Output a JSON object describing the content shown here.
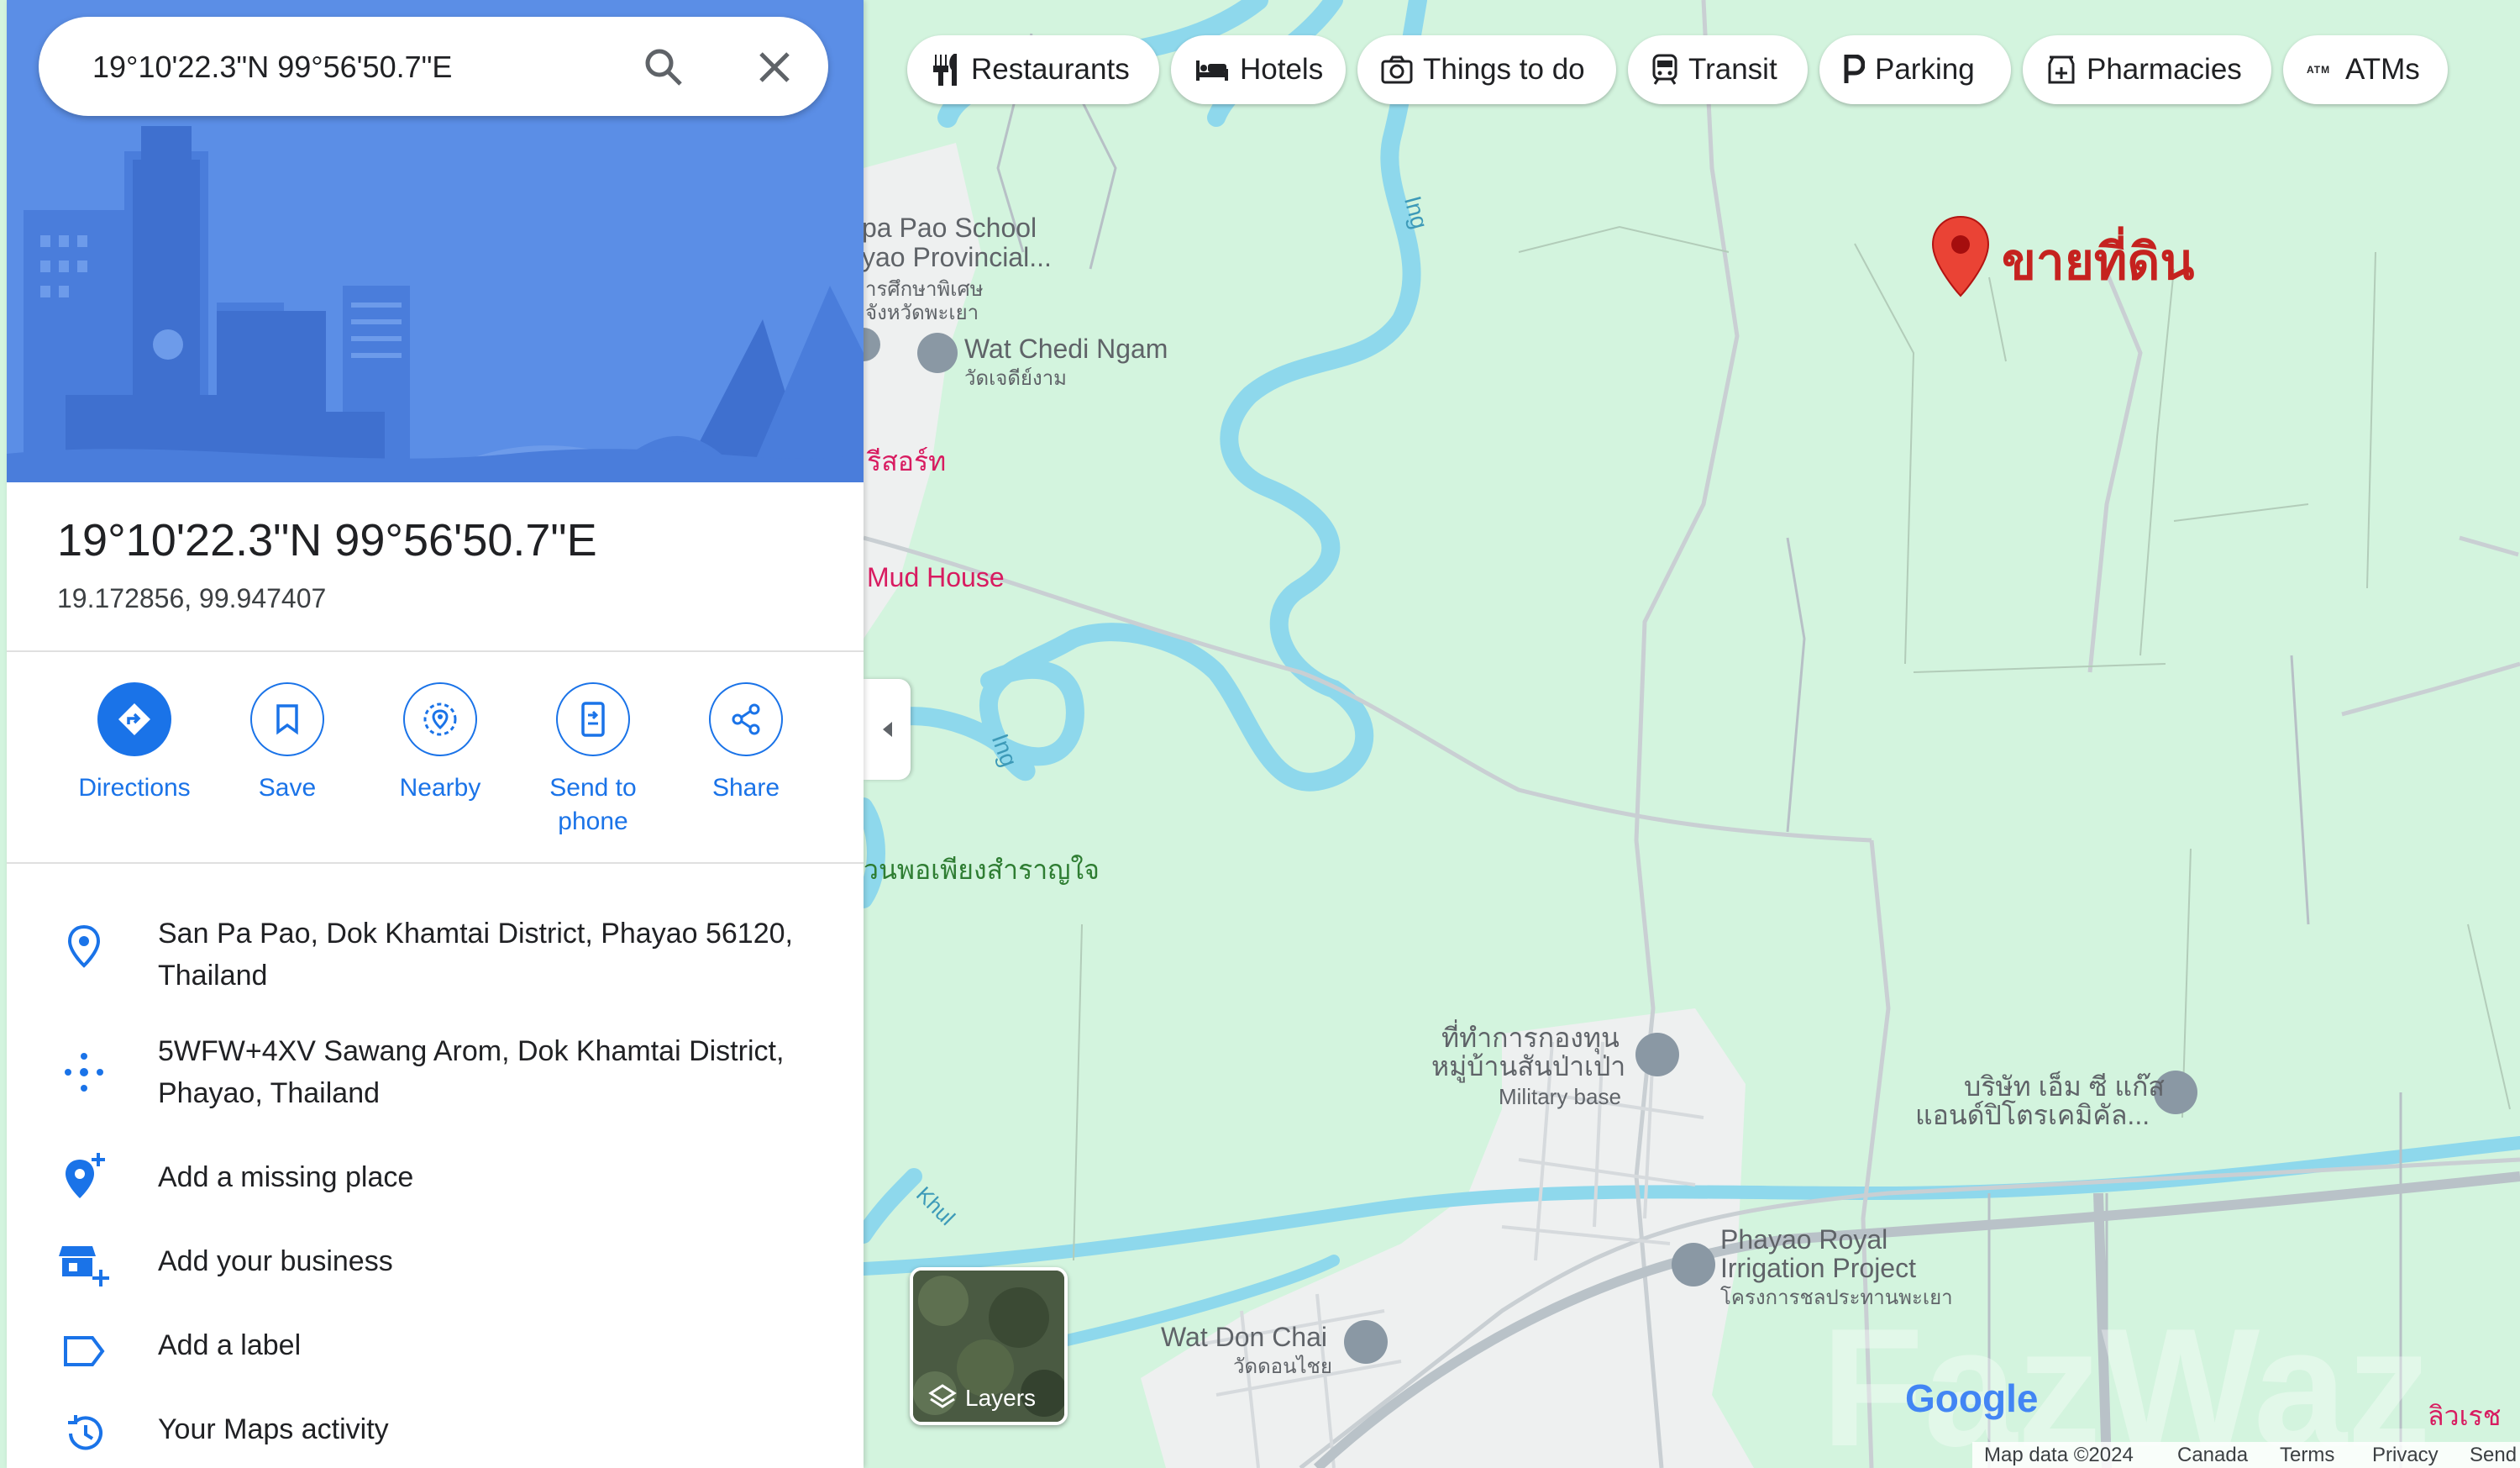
{
  "search": {
    "value": "19°10'22.3\"N 99°56'50.7\"E"
  },
  "place": {
    "title": "19°10'22.3\"N 99°56'50.7\"E",
    "decimal": "19.172856, 99.947407"
  },
  "actions": [
    {
      "label": "Directions",
      "icon": "directions-icon"
    },
    {
      "label": "Save",
      "icon": "bookmark-icon"
    },
    {
      "label": "Nearby",
      "icon": "nearby-icon"
    },
    {
      "label": "Send to\nphone",
      "icon": "send-to-phone-icon"
    },
    {
      "label": "Share",
      "icon": "share-icon"
    }
  ],
  "info": {
    "address": "San Pa Pao, Dok Khamtai District, Phayao 56120, Thailand",
    "plus_code": "5WFW+4XV Sawang Arom, Dok Khamtai District, Phayao, Thailand",
    "add_missing_place": "Add a missing place",
    "add_business": "Add your business",
    "add_label": "Add a label",
    "maps_activity": "Your Maps activity"
  },
  "chips": [
    "Restaurants",
    "Hotels",
    "Things to do",
    "Transit",
    "Parking",
    "Pharmacies",
    "ATMs"
  ],
  "map": {
    "pin_label": "ขายที่ดิน",
    "labels": {
      "school1": "pa Pao School",
      "school2": "yao Provincial...",
      "school3": "ารศึกษาพิเศษ",
      "school4": "จังหวัดพะเยา",
      "wat_chedi": "Wat Chedi Ngam",
      "wat_chedi_th": "วัดเจดีย์งาม",
      "resort": "รีสอร์ท",
      "mud_house": "Mud House",
      "river1": "Ing",
      "river2": "Ing",
      "river3": "Khul",
      "garden": "วนพอเพียงสำราญใจ",
      "military1": "ที่ทำการกองทุน",
      "military2": "หมู่บ้านสันป่าเป่า",
      "military3": "Military base",
      "company1": "บริษัท เอ็ม ซี แก๊ส",
      "company2": "แอนด์ปิโตรเคมิคัล...",
      "irrigation1": "Phayao Royal",
      "irrigation2": "Irrigation Project",
      "irrigation3": "โครงการชลประทานพะเยา",
      "wat_don": "Wat Don Chai",
      "wat_don_th": "วัดดอนไชย",
      "corner": "ลิวเรช",
      "google": "Google",
      "watermark": "FazWaz"
    },
    "layers_label": "Layers"
  },
  "footer": {
    "map_data": "Map data ©2024",
    "region": "Canada",
    "terms": "Terms",
    "privacy": "Privacy",
    "send": "Send"
  },
  "colors": {
    "accent": "#1a73e8",
    "map_bg": "#d3f4de",
    "water": "#8ed8ec",
    "pin": "#ea4335",
    "pin_label": "#c5221f"
  }
}
